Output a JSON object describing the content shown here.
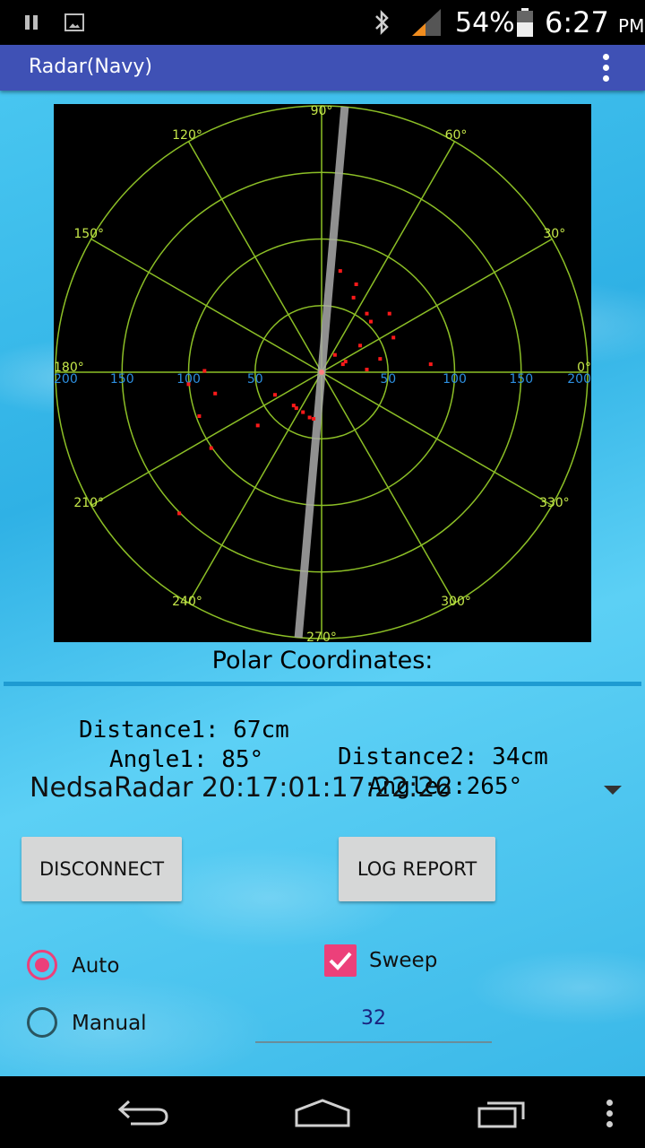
{
  "status_bar": {
    "battery_percent": "54%",
    "time": "6:27",
    "ampm": "PM"
  },
  "app_bar": {
    "title": "Radar(Navy)"
  },
  "radar": {
    "angle_labels": [
      {
        "text": "90°",
        "angle": 90
      },
      {
        "text": "60°",
        "angle": 60
      },
      {
        "text": "30°",
        "angle": 30
      },
      {
        "text": "0°",
        "angle": 0
      },
      {
        "text": "330°",
        "angle": 330
      },
      {
        "text": "300°",
        "angle": 300
      },
      {
        "text": "270°",
        "angle": 270
      },
      {
        "text": "240°",
        "angle": 240
      },
      {
        "text": "210°",
        "angle": 210
      },
      {
        "text": "180°",
        "angle": 180
      },
      {
        "text": "150°",
        "angle": 150
      },
      {
        "text": "120°",
        "angle": 120
      }
    ],
    "distance_labels": [
      {
        "text": "200",
        "value": -200
      },
      {
        "text": "150",
        "value": -150
      },
      {
        "text": "100",
        "value": -100
      },
      {
        "text": "50",
        "value": -50
      },
      {
        "text": "50",
        "value": 50
      },
      {
        "text": "100",
        "value": 100
      },
      {
        "text": "150",
        "value": 150
      },
      {
        "text": "200",
        "value": 200
      }
    ],
    "ring_values": [
      50,
      100,
      150,
      200
    ],
    "max_range": 200,
    "sweep_angle": 85,
    "points": [
      [
        14,
        76
      ],
      [
        26,
        66
      ],
      [
        24,
        56
      ],
      [
        34,
        44
      ],
      [
        51,
        44
      ],
      [
        37,
        38
      ],
      [
        54,
        26
      ],
      [
        29,
        20
      ],
      [
        44,
        10
      ],
      [
        10,
        13
      ],
      [
        18,
        8
      ],
      [
        16,
        6
      ],
      [
        34,
        2
      ],
      [
        82,
        6
      ],
      [
        -88,
        1
      ],
      [
        -100,
        -9
      ],
      [
        -80,
        -16
      ],
      [
        -35,
        -17
      ],
      [
        -92,
        -33
      ],
      [
        -83,
        -57
      ],
      [
        -48,
        -40
      ],
      [
        -21,
        -25
      ],
      [
        -19,
        -27
      ],
      [
        -14,
        -30
      ],
      [
        -9,
        -34
      ],
      [
        -6,
        -35
      ],
      [
        -107,
        -106
      ]
    ],
    "colors": {
      "grid": "#8cbf26",
      "angle_label": "#c6e84a",
      "distance_label": "#2d8fe0",
      "point": "#ff1a1a",
      "sweep": "#aaaaaa"
    }
  },
  "polar": {
    "heading": "Polar Coordinates:",
    "distance1": "Distance1: 67cm",
    "distance2": "Distance2: 34cm",
    "angle1": "Angle1: 85°",
    "angle2": "Angle2:265°"
  },
  "device": {
    "selected": "NedsaRadar 20:17:01:17:22:26"
  },
  "buttons": {
    "disconnect": "DISCONNECT",
    "log_report": "LOG REPORT"
  },
  "mode": {
    "auto_label": "Auto",
    "manual_label": "Manual",
    "selected": "auto"
  },
  "sweep": {
    "label": "Sweep",
    "checked": true
  },
  "manual_value": "32",
  "theme": {
    "accent": "#ec407a",
    "app_bar": "#3f51b5"
  }
}
